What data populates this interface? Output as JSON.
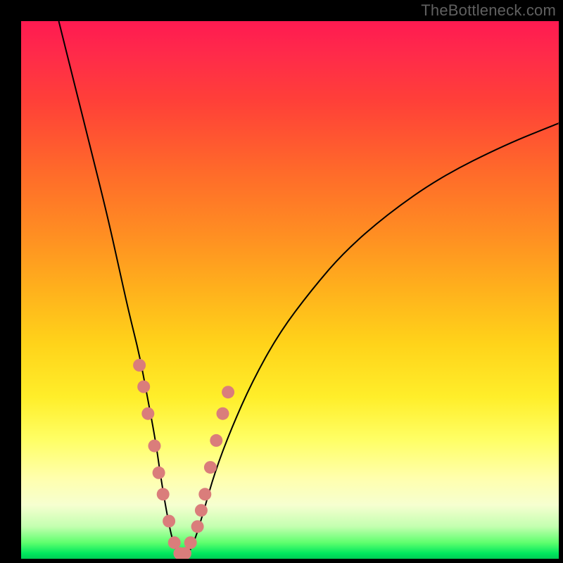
{
  "watermark": "TheBottleneck.com",
  "colors": {
    "marker": "#da7d7b",
    "curve": "#000000",
    "frame": "#000000"
  },
  "chart_data": {
    "type": "line",
    "title": "",
    "xlabel": "",
    "ylabel": "",
    "xlim": [
      0,
      100
    ],
    "ylim": [
      0,
      100
    ],
    "series": [
      {
        "name": "bottleneck-curve",
        "x": [
          7,
          10,
          13,
          16,
          18,
          20,
          22,
          23.5,
          25,
          26,
          27,
          28,
          29,
          30,
          31.2,
          32.5,
          34,
          36,
          39,
          43,
          48,
          54,
          60,
          68,
          78,
          90,
          100
        ],
        "y": [
          100,
          88,
          76,
          64,
          55,
          46,
          38,
          30,
          22,
          15,
          9,
          4,
          1,
          0,
          1,
          4,
          9,
          16,
          24,
          33,
          42,
          50,
          57,
          64,
          71,
          77,
          81
        ]
      }
    ],
    "markers": {
      "name": "highlighted-points",
      "x": [
        22.0,
        22.8,
        23.6,
        24.8,
        25.6,
        26.4,
        27.5,
        28.5,
        29.5,
        30.5,
        31.5,
        32.8,
        33.5,
        34.2,
        35.2,
        36.3,
        37.5,
        38.5
      ],
      "y": [
        36,
        32,
        27,
        21,
        16,
        12,
        7,
        3,
        1,
        1,
        3,
        6,
        9,
        12,
        17,
        22,
        27,
        31
      ]
    }
  }
}
